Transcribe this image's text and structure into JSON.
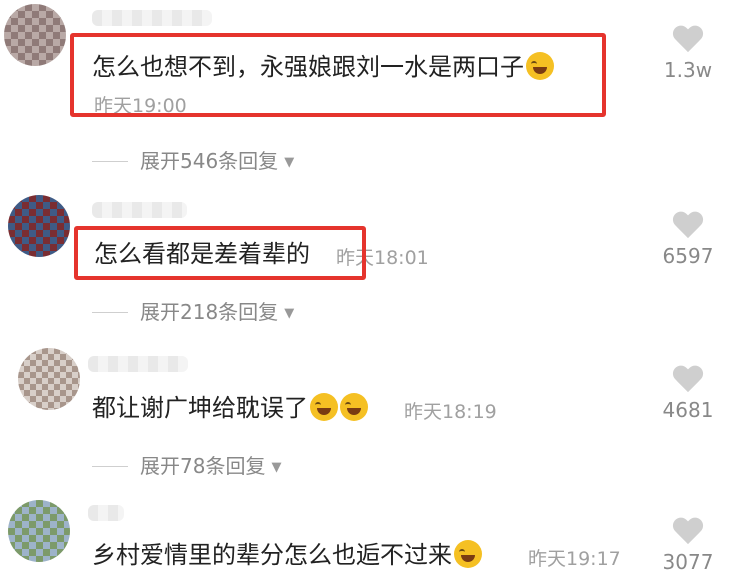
{
  "comments": [
    {
      "text": "怎么也想不到，永强娘跟刘一水是两口子",
      "time": "昨天19:00",
      "expand": "展开546条回复",
      "likes": "1.3w",
      "emoji": "rofl-emoji"
    },
    {
      "text": "怎么看都是差着辈的",
      "time": "昨天18:01",
      "expand": "展开218条回复",
      "likes": "6597"
    },
    {
      "text": "都让谢广坤给耽误了",
      "time": "昨天18:19",
      "expand": "展开78条回复",
      "likes": "4681",
      "emoji": "rofl-emoji"
    },
    {
      "text": "乡村爱情里的辈分怎么也逅不过来",
      "time": "昨天19:17",
      "likes": "3077"
    }
  ],
  "colors": {
    "highlight": "#e5342d",
    "muted": "#9b9b9b",
    "text": "#222222"
  }
}
